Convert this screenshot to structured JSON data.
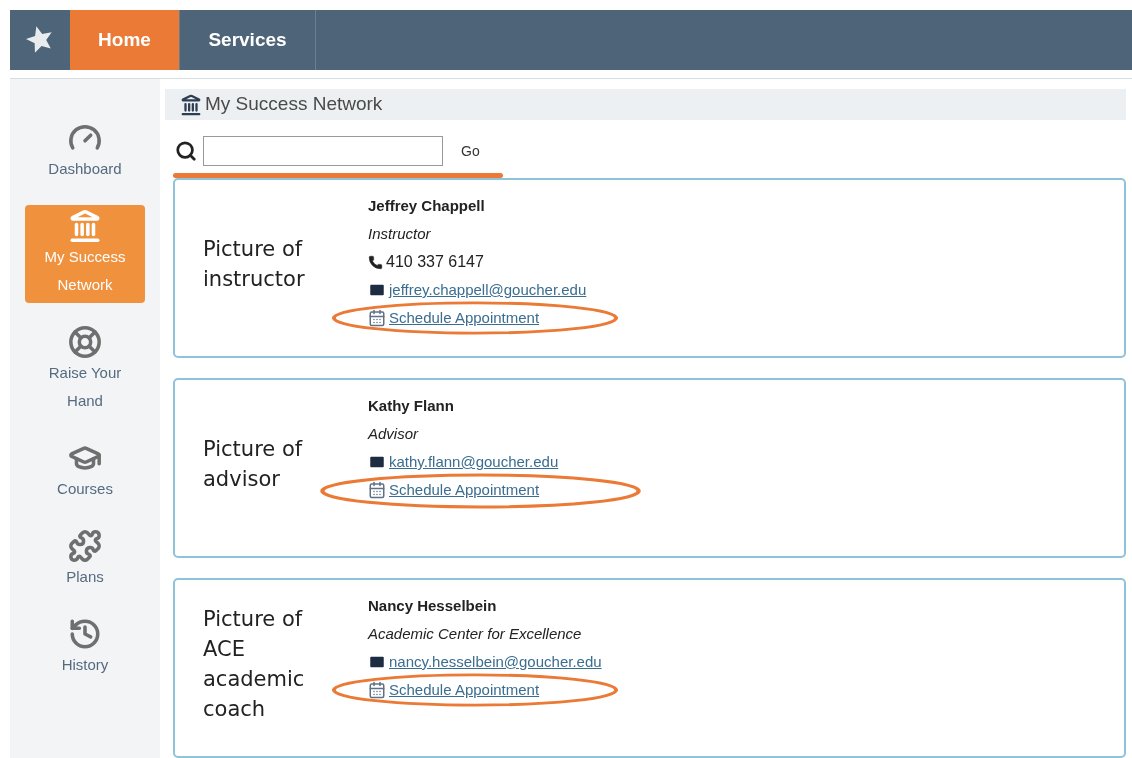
{
  "nav": {
    "tabs": [
      {
        "label": "Home",
        "selected": true
      },
      {
        "label": "Services",
        "selected": false
      }
    ]
  },
  "sidebar": {
    "items": [
      {
        "label": "Dashboard",
        "selected": false
      },
      {
        "label": "My Success Network",
        "selected": true
      },
      {
        "label": "Raise Your Hand",
        "selected": false
      },
      {
        "label": "Courses",
        "selected": false
      },
      {
        "label": "Plans",
        "selected": false
      },
      {
        "label": "History",
        "selected": false
      }
    ]
  },
  "page_title": "My Success Network",
  "search": {
    "button": "Go"
  },
  "contacts": [
    {
      "picture_caption": "Picture of instructor",
      "name": "Jeffrey Chappell",
      "role": "Instructor",
      "phone": "410 337 6147",
      "email": "jeffrey.chappell@goucher.edu",
      "schedule_link": "Schedule Appointment"
    },
    {
      "picture_caption": "Picture of advisor",
      "name": "Kathy Flann",
      "role": "Advisor",
      "email": "kathy.flann@goucher.edu",
      "schedule_link": "Schedule Appointment"
    },
    {
      "picture_caption": "Picture of ACE academic coach",
      "name": "Nancy Hesselbein",
      "role": "Academic Center for Excellence",
      "email": "nancy.hesselbein@goucher.edu",
      "schedule_link": "Schedule Appointment"
    }
  ]
}
